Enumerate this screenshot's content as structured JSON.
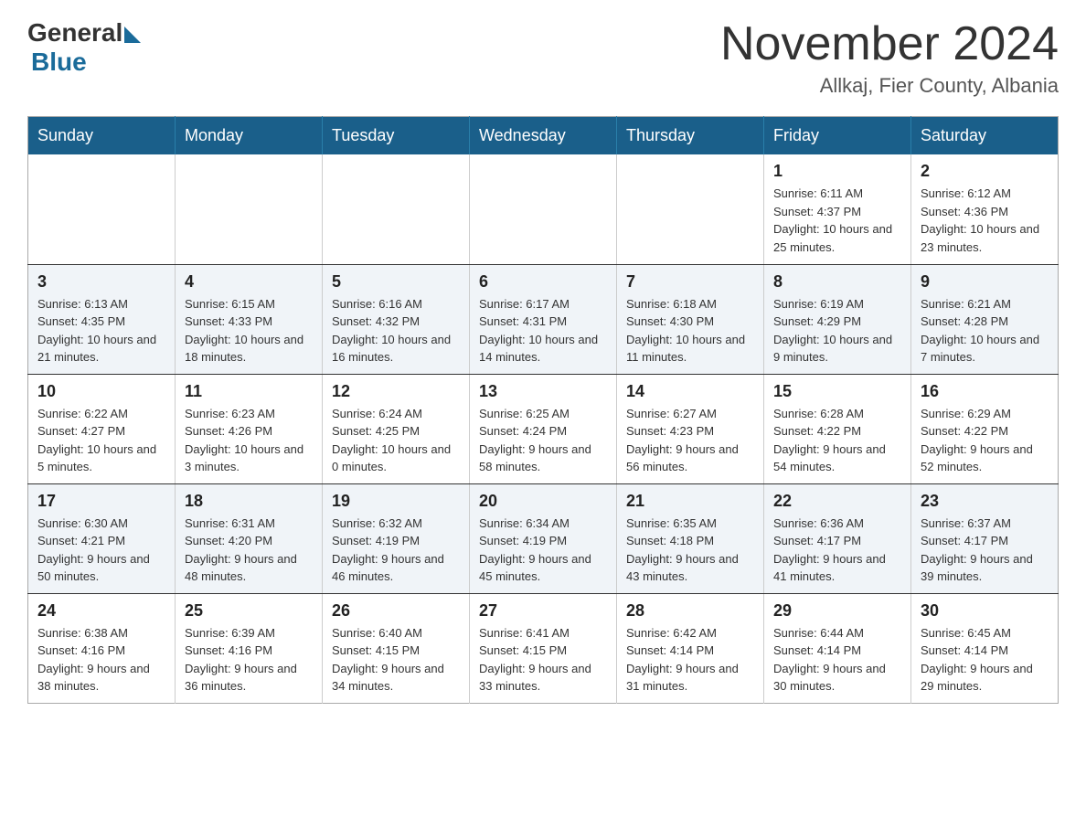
{
  "header": {
    "logo_general": "General",
    "logo_blue": "Blue",
    "month_title": "November 2024",
    "location": "Allkaj, Fier County, Albania"
  },
  "days_of_week": [
    "Sunday",
    "Monday",
    "Tuesday",
    "Wednesday",
    "Thursday",
    "Friday",
    "Saturday"
  ],
  "weeks": [
    [
      {
        "day": "",
        "sunrise": "",
        "sunset": "",
        "daylight": ""
      },
      {
        "day": "",
        "sunrise": "",
        "sunset": "",
        "daylight": ""
      },
      {
        "day": "",
        "sunrise": "",
        "sunset": "",
        "daylight": ""
      },
      {
        "day": "",
        "sunrise": "",
        "sunset": "",
        "daylight": ""
      },
      {
        "day": "",
        "sunrise": "",
        "sunset": "",
        "daylight": ""
      },
      {
        "day": "1",
        "sunrise": "Sunrise: 6:11 AM",
        "sunset": "Sunset: 4:37 PM",
        "daylight": "Daylight: 10 hours and 25 minutes."
      },
      {
        "day": "2",
        "sunrise": "Sunrise: 6:12 AM",
        "sunset": "Sunset: 4:36 PM",
        "daylight": "Daylight: 10 hours and 23 minutes."
      }
    ],
    [
      {
        "day": "3",
        "sunrise": "Sunrise: 6:13 AM",
        "sunset": "Sunset: 4:35 PM",
        "daylight": "Daylight: 10 hours and 21 minutes."
      },
      {
        "day": "4",
        "sunrise": "Sunrise: 6:15 AM",
        "sunset": "Sunset: 4:33 PM",
        "daylight": "Daylight: 10 hours and 18 minutes."
      },
      {
        "day": "5",
        "sunrise": "Sunrise: 6:16 AM",
        "sunset": "Sunset: 4:32 PM",
        "daylight": "Daylight: 10 hours and 16 minutes."
      },
      {
        "day": "6",
        "sunrise": "Sunrise: 6:17 AM",
        "sunset": "Sunset: 4:31 PM",
        "daylight": "Daylight: 10 hours and 14 minutes."
      },
      {
        "day": "7",
        "sunrise": "Sunrise: 6:18 AM",
        "sunset": "Sunset: 4:30 PM",
        "daylight": "Daylight: 10 hours and 11 minutes."
      },
      {
        "day": "8",
        "sunrise": "Sunrise: 6:19 AM",
        "sunset": "Sunset: 4:29 PM",
        "daylight": "Daylight: 10 hours and 9 minutes."
      },
      {
        "day": "9",
        "sunrise": "Sunrise: 6:21 AM",
        "sunset": "Sunset: 4:28 PM",
        "daylight": "Daylight: 10 hours and 7 minutes."
      }
    ],
    [
      {
        "day": "10",
        "sunrise": "Sunrise: 6:22 AM",
        "sunset": "Sunset: 4:27 PM",
        "daylight": "Daylight: 10 hours and 5 minutes."
      },
      {
        "day": "11",
        "sunrise": "Sunrise: 6:23 AM",
        "sunset": "Sunset: 4:26 PM",
        "daylight": "Daylight: 10 hours and 3 minutes."
      },
      {
        "day": "12",
        "sunrise": "Sunrise: 6:24 AM",
        "sunset": "Sunset: 4:25 PM",
        "daylight": "Daylight: 10 hours and 0 minutes."
      },
      {
        "day": "13",
        "sunrise": "Sunrise: 6:25 AM",
        "sunset": "Sunset: 4:24 PM",
        "daylight": "Daylight: 9 hours and 58 minutes."
      },
      {
        "day": "14",
        "sunrise": "Sunrise: 6:27 AM",
        "sunset": "Sunset: 4:23 PM",
        "daylight": "Daylight: 9 hours and 56 minutes."
      },
      {
        "day": "15",
        "sunrise": "Sunrise: 6:28 AM",
        "sunset": "Sunset: 4:22 PM",
        "daylight": "Daylight: 9 hours and 54 minutes."
      },
      {
        "day": "16",
        "sunrise": "Sunrise: 6:29 AM",
        "sunset": "Sunset: 4:22 PM",
        "daylight": "Daylight: 9 hours and 52 minutes."
      }
    ],
    [
      {
        "day": "17",
        "sunrise": "Sunrise: 6:30 AM",
        "sunset": "Sunset: 4:21 PM",
        "daylight": "Daylight: 9 hours and 50 minutes."
      },
      {
        "day": "18",
        "sunrise": "Sunrise: 6:31 AM",
        "sunset": "Sunset: 4:20 PM",
        "daylight": "Daylight: 9 hours and 48 minutes."
      },
      {
        "day": "19",
        "sunrise": "Sunrise: 6:32 AM",
        "sunset": "Sunset: 4:19 PM",
        "daylight": "Daylight: 9 hours and 46 minutes."
      },
      {
        "day": "20",
        "sunrise": "Sunrise: 6:34 AM",
        "sunset": "Sunset: 4:19 PM",
        "daylight": "Daylight: 9 hours and 45 minutes."
      },
      {
        "day": "21",
        "sunrise": "Sunrise: 6:35 AM",
        "sunset": "Sunset: 4:18 PM",
        "daylight": "Daylight: 9 hours and 43 minutes."
      },
      {
        "day": "22",
        "sunrise": "Sunrise: 6:36 AM",
        "sunset": "Sunset: 4:17 PM",
        "daylight": "Daylight: 9 hours and 41 minutes."
      },
      {
        "day": "23",
        "sunrise": "Sunrise: 6:37 AM",
        "sunset": "Sunset: 4:17 PM",
        "daylight": "Daylight: 9 hours and 39 minutes."
      }
    ],
    [
      {
        "day": "24",
        "sunrise": "Sunrise: 6:38 AM",
        "sunset": "Sunset: 4:16 PM",
        "daylight": "Daylight: 9 hours and 38 minutes."
      },
      {
        "day": "25",
        "sunrise": "Sunrise: 6:39 AM",
        "sunset": "Sunset: 4:16 PM",
        "daylight": "Daylight: 9 hours and 36 minutes."
      },
      {
        "day": "26",
        "sunrise": "Sunrise: 6:40 AM",
        "sunset": "Sunset: 4:15 PM",
        "daylight": "Daylight: 9 hours and 34 minutes."
      },
      {
        "day": "27",
        "sunrise": "Sunrise: 6:41 AM",
        "sunset": "Sunset: 4:15 PM",
        "daylight": "Daylight: 9 hours and 33 minutes."
      },
      {
        "day": "28",
        "sunrise": "Sunrise: 6:42 AM",
        "sunset": "Sunset: 4:14 PM",
        "daylight": "Daylight: 9 hours and 31 minutes."
      },
      {
        "day": "29",
        "sunrise": "Sunrise: 6:44 AM",
        "sunset": "Sunset: 4:14 PM",
        "daylight": "Daylight: 9 hours and 30 minutes."
      },
      {
        "day": "30",
        "sunrise": "Sunrise: 6:45 AM",
        "sunset": "Sunset: 4:14 PM",
        "daylight": "Daylight: 9 hours and 29 minutes."
      }
    ]
  ]
}
